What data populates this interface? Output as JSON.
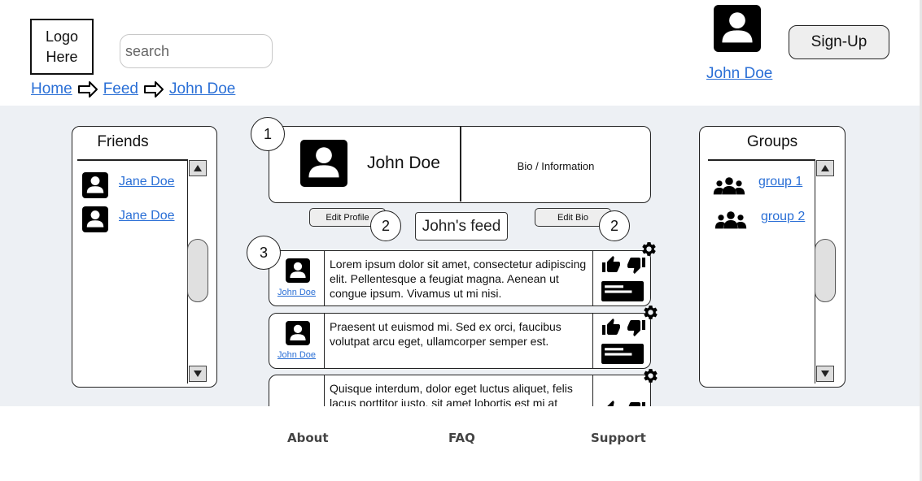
{
  "header": {
    "logo_text": "Logo\nHere",
    "search_placeholder": "search",
    "breadcrumbs": [
      "Home",
      "Feed",
      "John Doe"
    ],
    "user_name": "John Doe",
    "signup_label": "Sign-Up"
  },
  "friends": {
    "title": "Friends",
    "items": [
      {
        "name": "Jane Doe"
      },
      {
        "name": "Jane Doe"
      }
    ]
  },
  "profile": {
    "number": "1",
    "name": "John Doe",
    "bio": "Bio / Information",
    "edit_profile_label": "Edit Profile",
    "edit_bio_label": "Edit Bio",
    "edit_profile_number": "2",
    "edit_bio_number": "2",
    "feed_label": "John's feed"
  },
  "feed": {
    "number": "3",
    "posts": [
      {
        "author": "John Doe",
        "text": "Lorem ipsum dolor sit amet, consectetur adipiscing elit. Pellentesque a feugiat magna. Aenean ut congue ipsum. Vivamus ut mi nisi."
      },
      {
        "author": "John Doe",
        "text": "Praesent ut euismod mi. Sed ex orci, faucibus volutpat arcu eget, ullamcorper semper est."
      },
      {
        "author": "",
        "text": "Quisque interdum, dolor eget luctus aliquet, felis lacus porttitor justo, sit amet lobortis est mi at ligula."
      }
    ]
  },
  "groups": {
    "title": "Groups",
    "items": [
      {
        "name": "group 1"
      },
      {
        "name": "group 2"
      }
    ]
  },
  "footer": {
    "links": [
      "About",
      "FAQ",
      "Support"
    ]
  },
  "icons": {
    "user": "user-icon",
    "group": "group-icon",
    "thumbs_up": "thumbs-up-icon",
    "thumbs_down": "thumbs-down-icon",
    "comment": "comment-icon",
    "settings": "gear-icon",
    "arrow": "arrow-right-icon"
  },
  "colors": {
    "link": "#2a6fd6",
    "main_background": "#edf0f4"
  }
}
